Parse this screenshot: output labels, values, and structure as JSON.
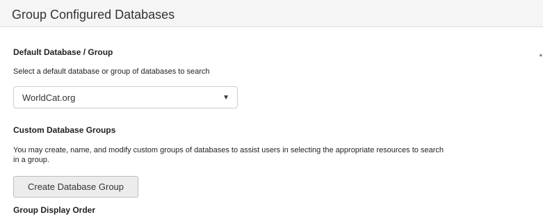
{
  "panel": {
    "title": "Group Configured Databases"
  },
  "default_section": {
    "title": "Default Database / Group",
    "help": "Select a default database or group of databases to search",
    "select_value": "WorldCat.org",
    "select_arrow": "▼",
    "marker": "*"
  },
  "custom_section": {
    "title": "Custom Database Groups",
    "help_line1": "You may create, name, and modify custom groups of databases to assist users in selecting the appropriate resources to search",
    "help_line2": "in a group.",
    "button_label": "Create Database Group"
  },
  "order_section": {
    "title": "Group Display Order"
  }
}
